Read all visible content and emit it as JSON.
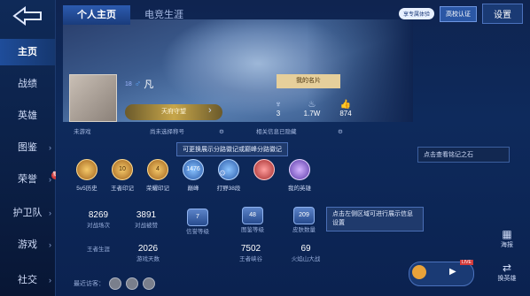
{
  "nav": {
    "items": [
      {
        "label": "主页",
        "active": true
      },
      {
        "label": "战绩"
      },
      {
        "label": "英雄"
      },
      {
        "label": "图鉴",
        "chev": "›"
      },
      {
        "label": "荣誉",
        "chev": "›",
        "badge": "新"
      },
      {
        "label": "护卫队",
        "chev": "›"
      },
      {
        "label": "游戏",
        "chev": "›"
      },
      {
        "label": "社交",
        "chev": "›"
      }
    ]
  },
  "header": {
    "tabs": [
      {
        "label": "个人主页",
        "active": true
      },
      {
        "label": "电竞生涯"
      }
    ],
    "vip_label": "享专属体验",
    "campus_label": "高校认证",
    "settings_label": "设置"
  },
  "profile": {
    "name": "凡",
    "level": "18",
    "gender_icon": "male-icon",
    "title_badge": "天府守望",
    "card_button": "我的名片",
    "stats": [
      {
        "icon": "person-icon",
        "value": "3"
      },
      {
        "icon": "flame-icon",
        "value": "1.7W"
      },
      {
        "icon": "thumbs-up-icon",
        "value": "874"
      }
    ],
    "tag_left": "未游戏",
    "tag_middle": "尚未选择称号",
    "tag_right": "相关信息已隐藏",
    "tip": "可更换展示分路徽记或巅峰分路徽记"
  },
  "honors": [
    {
      "label": "5v5历史",
      "icon": "gold",
      "value": ""
    },
    {
      "label": "王者印记",
      "icon": "gold",
      "value": "10"
    },
    {
      "label": "荣耀印记",
      "icon": "gold",
      "value": "4"
    },
    {
      "label": "巅峰",
      "icon": "blue",
      "value": "1476"
    },
    {
      "label": "打野38段",
      "icon": "blue",
      "value": ""
    },
    {
      "label": "",
      "icon": "red",
      "value": ""
    },
    {
      "label": "我的英雄",
      "icon": "purple",
      "value": ""
    }
  ],
  "stats_grid": [
    {
      "value": "8269",
      "label": "对战场次"
    },
    {
      "value": "3891",
      "label": "对战被赞"
    },
    {
      "value": "7",
      "label": "信誉等级",
      "emblem": true
    },
    {
      "value": "48",
      "label": "图鉴等级",
      "emblem": true
    },
    {
      "value": "209",
      "label": "皮肤数量",
      "emblem": true
    },
    {
      "value": "",
      "label": "王者生涯"
    },
    {
      "value": "2026",
      "label": "游戏天数"
    },
    {
      "value": "7502",
      "label": "王者峡谷"
    },
    {
      "value": "69",
      "label": "火焰山大战"
    }
  ],
  "info_tip": "点击左侧区域可进行展示信息设置",
  "inscription_tip": "点击查看铭记之石",
  "recent_label": "最近访客：",
  "right_icons": [
    {
      "label": "海报"
    },
    {
      "label": "换英雄"
    }
  ],
  "live_badge": "LIVE"
}
